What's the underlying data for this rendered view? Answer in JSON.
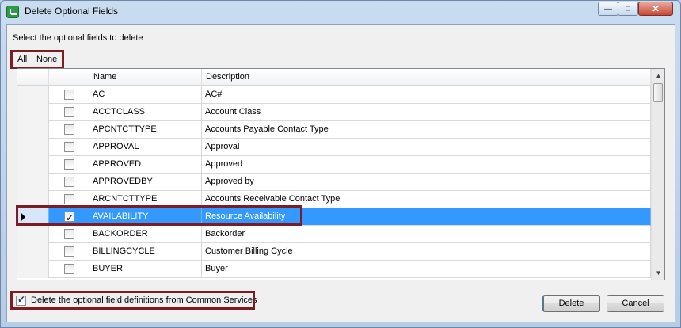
{
  "window": {
    "title": "Delete Optional Fields",
    "minimize_glyph": "—",
    "maximize_glyph": "□",
    "close_glyph": "✕"
  },
  "instruction": "Select the optional fields to delete",
  "selection_links": {
    "all": "All",
    "none": "None"
  },
  "grid": {
    "columns": {
      "name": "Name",
      "description": "Description"
    },
    "rows": [
      {
        "name": "AC",
        "description": "AC#",
        "checked": false,
        "selected": false
      },
      {
        "name": "ACCTCLASS",
        "description": "Account Class",
        "checked": false,
        "selected": false
      },
      {
        "name": "APCNTCTTYPE",
        "description": "Accounts Payable Contact Type",
        "checked": false,
        "selected": false
      },
      {
        "name": "APPROVAL",
        "description": "Approval",
        "checked": false,
        "selected": false
      },
      {
        "name": "APPROVED",
        "description": "Approved",
        "checked": false,
        "selected": false
      },
      {
        "name": "APPROVEDBY",
        "description": "Approved by",
        "checked": false,
        "selected": false
      },
      {
        "name": "ARCNTCTTYPE",
        "description": "Accounts Receivable Contact Type",
        "checked": false,
        "selected": false
      },
      {
        "name": "AVAILABILITY",
        "description": "Resource Availability",
        "checked": true,
        "selected": true
      },
      {
        "name": "BACKORDER",
        "description": "Backorder",
        "checked": false,
        "selected": false
      },
      {
        "name": "BILLINGCYCLE",
        "description": "Customer Billing Cycle",
        "checked": false,
        "selected": false
      },
      {
        "name": "BUYER",
        "description": "Buyer",
        "checked": false,
        "selected": false
      }
    ],
    "scroll_up_glyph": "▲",
    "scroll_down_glyph": "▼"
  },
  "delete_definitions": {
    "label": "Delete the optional field definitions from Common Services",
    "checked": true
  },
  "buttons": {
    "delete_hotkey": "D",
    "delete_rest": "elete",
    "cancel_hotkey": "C",
    "cancel_rest": "ancel"
  },
  "colors": {
    "highlight_box": "#7b1d22",
    "selection": "#3399ff"
  }
}
